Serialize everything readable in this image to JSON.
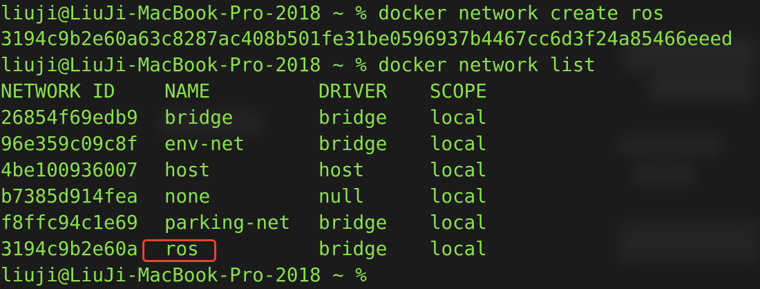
{
  "terminal": {
    "prompt": "liuji@LiuJi-MacBook-Pro-2018 ~ %",
    "command1": "docker network create ros",
    "output1": "3194c9b2e60a63c8287ac408b501fe31be0596937b4467cc6d3f24a85466eeed",
    "command2": "docker network list",
    "table": {
      "headers": {
        "id": "NETWORK ID",
        "name": "NAME",
        "driver": "DRIVER",
        "scope": "SCOPE"
      },
      "rows": [
        {
          "id": "26854f69edb9",
          "name": "bridge",
          "driver": "bridge",
          "scope": "local"
        },
        {
          "id": "96e359c09c8f",
          "name": "env-net",
          "driver": "bridge",
          "scope": "local"
        },
        {
          "id": "4be100936007",
          "name": "host",
          "driver": "host",
          "scope": "local"
        },
        {
          "id": "b7385d914fea",
          "name": "none",
          "driver": "null",
          "scope": "local"
        },
        {
          "id": "f8ffc94c1e69",
          "name": "parking-net",
          "driver": "bridge",
          "scope": "local"
        },
        {
          "id": "3194c9b2e60a",
          "name": "ros",
          "driver": "bridge",
          "scope": "local"
        }
      ]
    },
    "final_prompt": "liuji@LiuJi-MacBook-Pro-2018 ~ %"
  },
  "colors": {
    "background": "#1b1b1b",
    "text": "#8be04e",
    "highlight": "#e8432f"
  }
}
